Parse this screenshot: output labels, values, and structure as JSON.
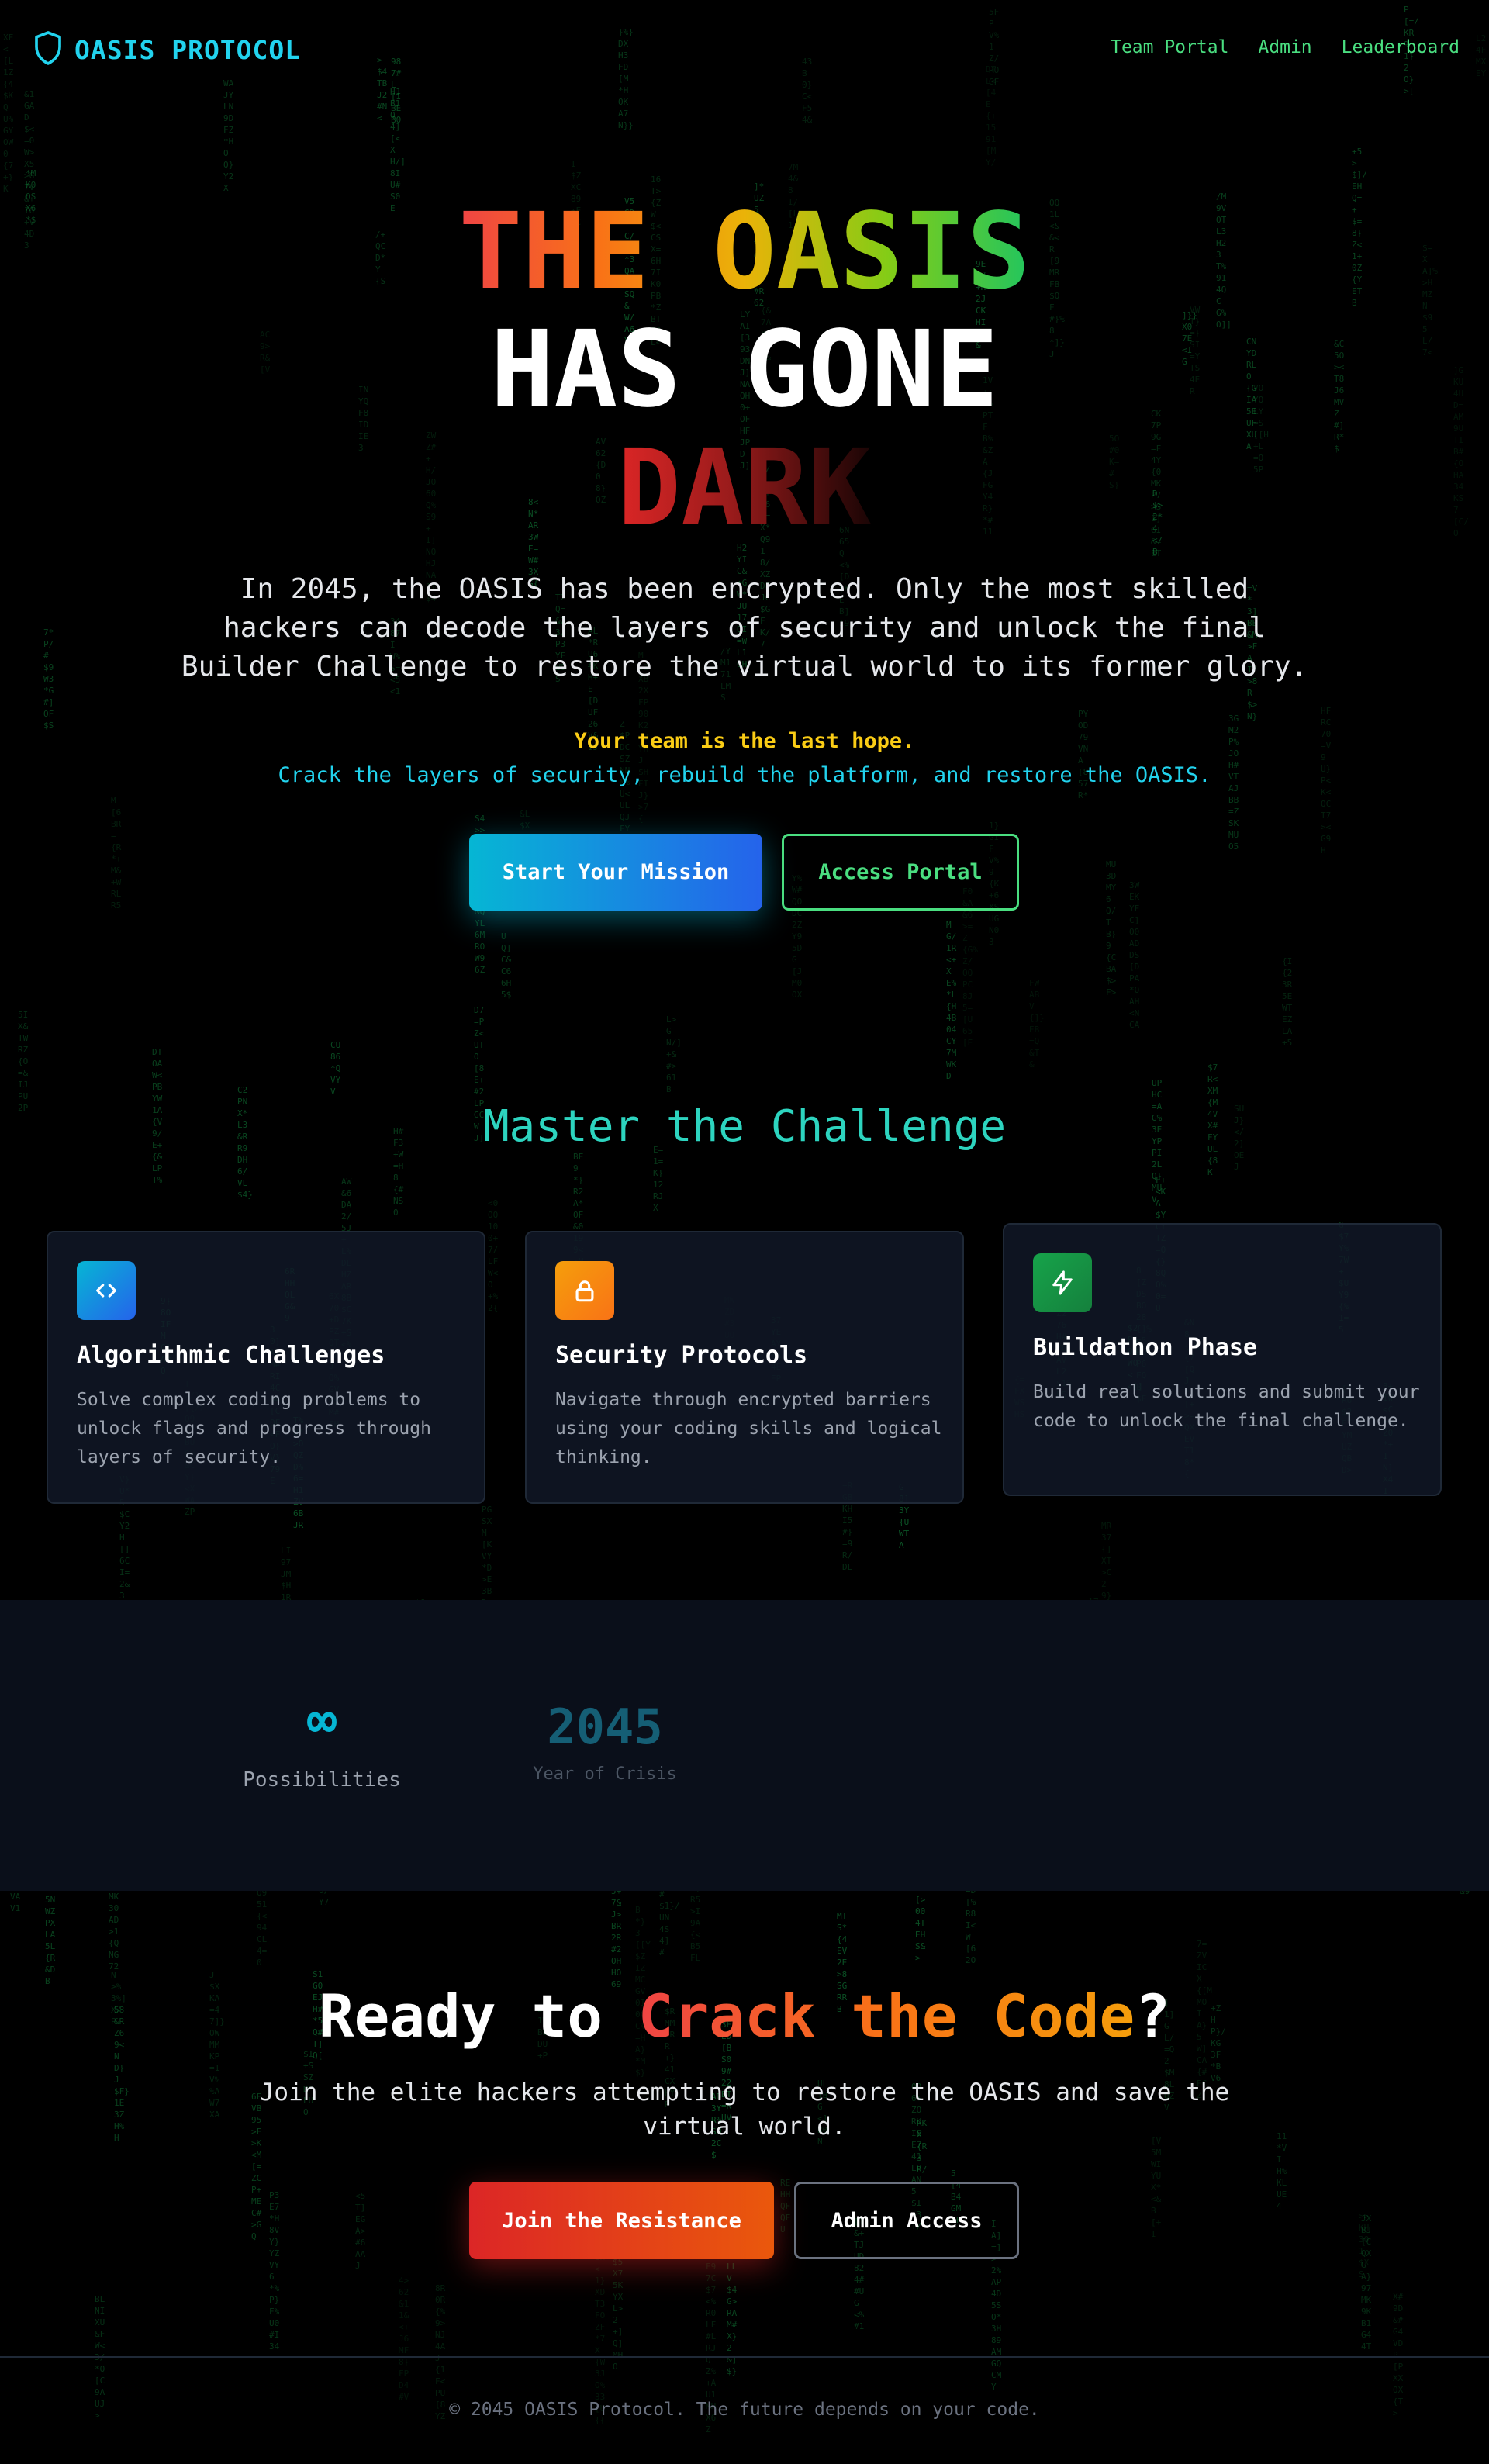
{
  "nav": {
    "brand": "OASIS PROTOCOL",
    "links": [
      "Team Portal",
      "Admin",
      "Leaderboard"
    ]
  },
  "hero": {
    "line1": "THE OASIS",
    "line2": "HAS GONE",
    "line3": "DARK",
    "description": "In 2045, the OASIS has been encrypted. Only the most skilled hackers can decode the layers of security and unlock the final Builder Challenge to restore the virtual world to its former glory.",
    "hope": "Your team is the last hope.",
    "crack": "Crack the layers of security, rebuild the platform, and restore the OASIS.",
    "primary_button": "Start Your Mission",
    "secondary_button": "Access Portal"
  },
  "challenge": {
    "title": "Master the Challenge",
    "cards": [
      {
        "icon": "code-icon",
        "color": "#2563eb",
        "title": "Algorithmic Challenges",
        "description": "Solve complex coding problems to unlock flags and progress through layers of security."
      },
      {
        "icon": "lock-icon",
        "color": "#f59e0b",
        "title": "Security Protocols",
        "description": "Navigate through encrypted barriers using your coding skills and logical thinking."
      },
      {
        "icon": "lightning-icon",
        "color": "#16a34a",
        "title": "Buildathon Phase",
        "description": "Build real solutions and submit your code to unlock the final challenge."
      }
    ]
  },
  "stats": [
    {
      "value": "∞",
      "label": "Possibilities"
    },
    {
      "value": "2045",
      "label": "Year of Crisis"
    }
  ],
  "cta": {
    "title_prefix": "Ready to ",
    "title_highlight": "Crack the Code",
    "title_suffix": "?",
    "description": "Join the elite hackers attempting to restore the OASIS and save the virtual world.",
    "primary_button": "Join the Resistance",
    "secondary_button": "Admin Access"
  },
  "footer": {
    "text": "© 2045 OASIS Protocol. The future depends on your code."
  },
  "colors": {
    "background": "#000000",
    "brand": "#22d3ee",
    "nav_link": "#4ade80",
    "accent_cyan": "#06b6d4",
    "accent_green": "#4ade80",
    "accent_red": "#dc2626",
    "hope_yellow": "#facc15",
    "title_teal": "#2dd4bf",
    "matrix_green": "#16a34a"
  }
}
